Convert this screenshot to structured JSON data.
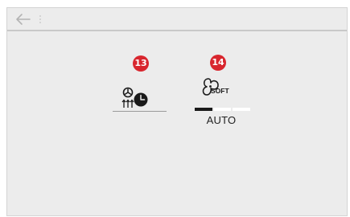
{
  "header": {
    "back_icon": "arrow-left-icon",
    "menu_icon": "vertical-dots-icon"
  },
  "annotations": {
    "recirculation_badge": "13",
    "soft_badge": "14"
  },
  "controls": {
    "recirculation_timer_icon": "air-recirculation-timer-icon",
    "soft_fan_icon": "fan-soft-icon",
    "soft_icon_text": "SOFT",
    "fan_level_segments": [
      true,
      false,
      false
    ],
    "mode_label": "AUTO"
  },
  "colors": {
    "badge": "#d8262e",
    "screen_background": "#ececec",
    "icon": "#1a1a1a"
  }
}
